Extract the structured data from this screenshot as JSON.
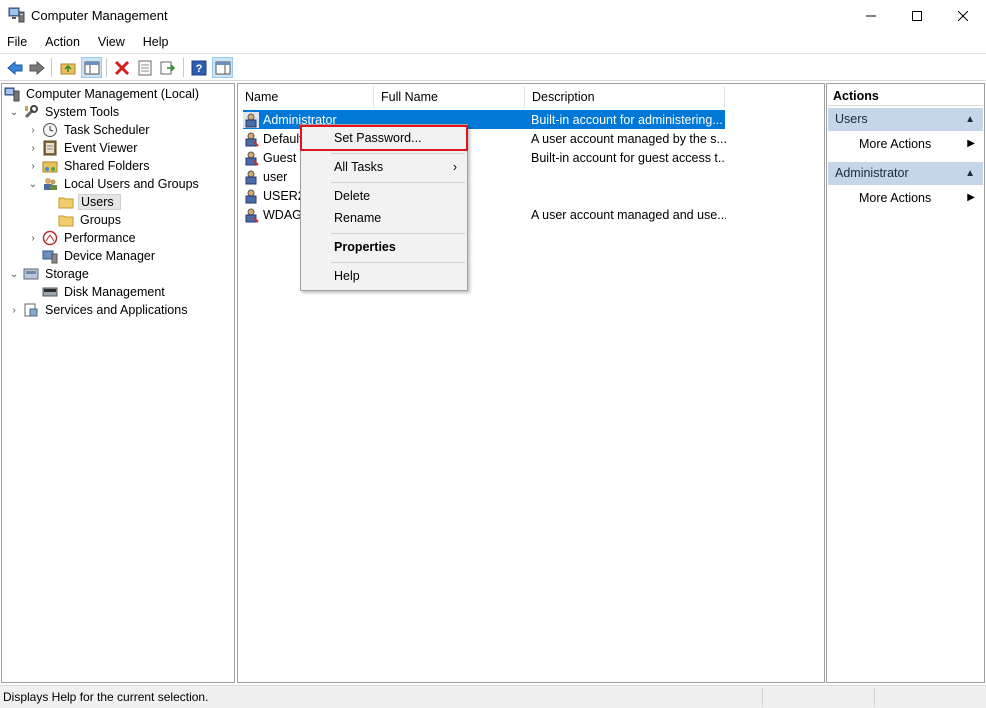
{
  "window": {
    "title": "Computer Management",
    "icon": "computer-management-icon"
  },
  "menu": [
    "File",
    "Action",
    "View",
    "Help"
  ],
  "toolbar": {
    "buttons": [
      "back-arrow-icon",
      "forward-arrow-icon",
      "up-folder-icon",
      "show-hide-tree-icon",
      "delete-icon",
      "properties-icon",
      "export-list-icon",
      "help-icon",
      "show-hide-action-pane-icon"
    ]
  },
  "tree": {
    "items": [
      {
        "label": "Computer Management (Local)",
        "icon": "computer-management-icon"
      },
      {
        "label": "System Tools",
        "icon": "tools-icon"
      },
      {
        "label": "Task Scheduler",
        "icon": "clock-icon"
      },
      {
        "label": "Event Viewer",
        "icon": "event-viewer-icon"
      },
      {
        "label": "Shared Folders",
        "icon": "shared-folder-icon"
      },
      {
        "label": "Local Users and Groups",
        "icon": "users-groups-icon"
      },
      {
        "label": "Users",
        "icon": "folder-icon"
      },
      {
        "label": "Groups",
        "icon": "folder-icon"
      },
      {
        "label": "Performance",
        "icon": "performance-icon"
      },
      {
        "label": "Device Manager",
        "icon": "device-manager-icon"
      },
      {
        "label": "Storage",
        "icon": "storage-icon"
      },
      {
        "label": "Disk Management",
        "icon": "disk-icon"
      },
      {
        "label": "Services and Applications",
        "icon": "services-icon"
      }
    ]
  },
  "list": {
    "columns": [
      "Name",
      "Full Name",
      "Description"
    ],
    "rows": [
      {
        "name": "Administrator",
        "full_name": "",
        "description": "Built-in account for administering..."
      },
      {
        "name": "Default",
        "full_name": "",
        "description": "A user account managed by the s..."
      },
      {
        "name": "Guest",
        "full_name": "",
        "description": "Built-in account for guest access t..."
      },
      {
        "name": "user",
        "full_name": "",
        "description": ""
      },
      {
        "name": "USER2",
        "full_name": "",
        "description": ""
      },
      {
        "name": "WDAGU",
        "full_name": "",
        "description": "A user account managed and use..."
      }
    ]
  },
  "context_menu": {
    "set_password": "Set Password...",
    "all_tasks": "All Tasks",
    "delete": "Delete",
    "rename": "Rename",
    "properties": "Properties",
    "help": "Help"
  },
  "actions": {
    "title": "Actions",
    "groups": [
      {
        "label": "Users",
        "item": "More Actions"
      },
      {
        "label": "Administrator",
        "item": "More Actions"
      }
    ]
  },
  "status": {
    "text": "Displays Help for the current selection."
  },
  "colors": {
    "selection": "#0078d7",
    "highlight_box": "#e0141e",
    "action_group_bg": "#c4d6e8"
  }
}
